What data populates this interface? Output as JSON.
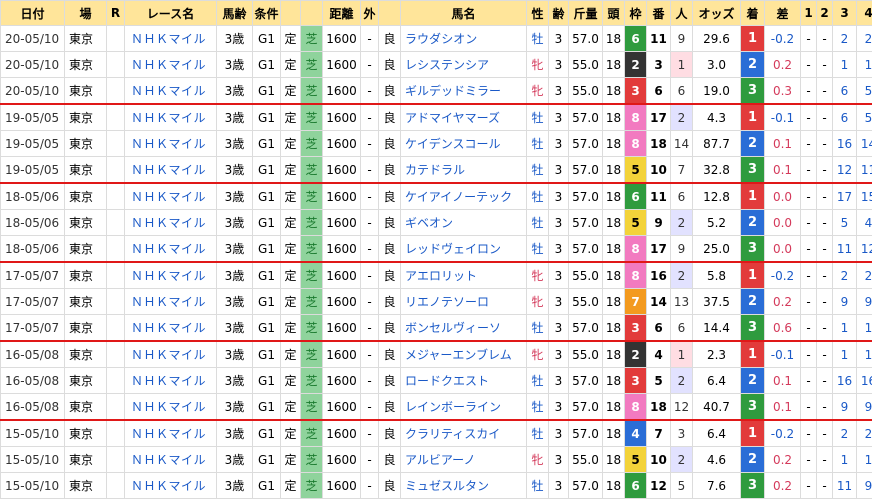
{
  "headers": [
    "日付",
    "場",
    "R",
    "レース名",
    "馬齢",
    "条件",
    "",
    "距離",
    "外",
    "",
    "馬名",
    "性",
    "齢",
    "斤量",
    "頭",
    "枠",
    "番",
    "人",
    "オッズ",
    "着",
    "差",
    "1",
    "2",
    "3",
    "4"
  ],
  "rows": [
    {
      "date": "20-05/10",
      "place": "東京",
      "race": "ＮＨＫマイル",
      "age": "3歳",
      "cond": "G1",
      "fix": "定",
      "surf": "芝",
      "dist": "1600",
      "out": "-",
      "going": "良",
      "horse": "ラウダシオン",
      "sex": "牡",
      "hage": "3",
      "weight": "57.0",
      "field": "18",
      "frame": "6",
      "num": "11",
      "pop": "9",
      "odds": "29.6",
      "finish": "1",
      "diff": "-0.2",
      "c1": "-",
      "c2": "-",
      "c3": "2",
      "c4": "2",
      "group_end": false
    },
    {
      "date": "20-05/10",
      "place": "東京",
      "race": "ＮＨＫマイル",
      "age": "3歳",
      "cond": "G1",
      "fix": "定",
      "surf": "芝",
      "dist": "1600",
      "out": "-",
      "going": "良",
      "horse": "レシステンシア",
      "sex": "牝",
      "hage": "3",
      "weight": "55.0",
      "field": "18",
      "frame": "2",
      "num": "3",
      "pop": "1",
      "odds": "3.0",
      "finish": "2",
      "diff": "0.2",
      "c1": "-",
      "c2": "-",
      "c3": "1",
      "c4": "1",
      "group_end": false
    },
    {
      "date": "20-05/10",
      "place": "東京",
      "race": "ＮＨＫマイル",
      "age": "3歳",
      "cond": "G1",
      "fix": "定",
      "surf": "芝",
      "dist": "1600",
      "out": "-",
      "going": "良",
      "horse": "ギルデッドミラー",
      "sex": "牝",
      "hage": "3",
      "weight": "55.0",
      "field": "18",
      "frame": "3",
      "num": "6",
      "pop": "6",
      "odds": "19.0",
      "finish": "3",
      "diff": "0.3",
      "c1": "-",
      "c2": "-",
      "c3": "6",
      "c4": "5",
      "group_end": true
    },
    {
      "date": "19-05/05",
      "place": "東京",
      "race": "ＮＨＫマイル",
      "age": "3歳",
      "cond": "G1",
      "fix": "定",
      "surf": "芝",
      "dist": "1600",
      "out": "-",
      "going": "良",
      "horse": "アドマイヤマーズ",
      "sex": "牡",
      "hage": "3",
      "weight": "57.0",
      "field": "18",
      "frame": "8",
      "num": "17",
      "pop": "2",
      "odds": "4.3",
      "finish": "1",
      "diff": "-0.1",
      "c1": "-",
      "c2": "-",
      "c3": "6",
      "c4": "5",
      "group_end": false
    },
    {
      "date": "19-05/05",
      "place": "東京",
      "race": "ＮＨＫマイル",
      "age": "3歳",
      "cond": "G1",
      "fix": "定",
      "surf": "芝",
      "dist": "1600",
      "out": "-",
      "going": "良",
      "horse": "ケイデンスコール",
      "sex": "牡",
      "hage": "3",
      "weight": "57.0",
      "field": "18",
      "frame": "8",
      "num": "18",
      "pop": "14",
      "odds": "87.7",
      "finish": "2",
      "diff": "0.1",
      "c1": "-",
      "c2": "-",
      "c3": "16",
      "c4": "14",
      "group_end": false
    },
    {
      "date": "19-05/05",
      "place": "東京",
      "race": "ＮＨＫマイル",
      "age": "3歳",
      "cond": "G1",
      "fix": "定",
      "surf": "芝",
      "dist": "1600",
      "out": "-",
      "going": "良",
      "horse": "カテドラル",
      "sex": "牡",
      "hage": "3",
      "weight": "57.0",
      "field": "18",
      "frame": "5",
      "num": "10",
      "pop": "7",
      "odds": "32.8",
      "finish": "3",
      "diff": "0.1",
      "c1": "-",
      "c2": "-",
      "c3": "12",
      "c4": "11",
      "group_end": true
    },
    {
      "date": "18-05/06",
      "place": "東京",
      "race": "ＮＨＫマイル",
      "age": "3歳",
      "cond": "G1",
      "fix": "定",
      "surf": "芝",
      "dist": "1600",
      "out": "-",
      "going": "良",
      "horse": "ケイアイノーテック",
      "sex": "牡",
      "hage": "3",
      "weight": "57.0",
      "field": "18",
      "frame": "6",
      "num": "11",
      "pop": "6",
      "odds": "12.8",
      "finish": "1",
      "diff": "0.0",
      "c1": "-",
      "c2": "-",
      "c3": "17",
      "c4": "15",
      "group_end": false
    },
    {
      "date": "18-05/06",
      "place": "東京",
      "race": "ＮＨＫマイル",
      "age": "3歳",
      "cond": "G1",
      "fix": "定",
      "surf": "芝",
      "dist": "1600",
      "out": "-",
      "going": "良",
      "horse": "ギベオン",
      "sex": "牡",
      "hage": "3",
      "weight": "57.0",
      "field": "18",
      "frame": "5",
      "num": "9",
      "pop": "2",
      "odds": "5.2",
      "finish": "2",
      "diff": "0.0",
      "c1": "-",
      "c2": "-",
      "c3": "5",
      "c4": "4",
      "group_end": false
    },
    {
      "date": "18-05/06",
      "place": "東京",
      "race": "ＮＨＫマイル",
      "age": "3歳",
      "cond": "G1",
      "fix": "定",
      "surf": "芝",
      "dist": "1600",
      "out": "-",
      "going": "良",
      "horse": "レッドヴェイロン",
      "sex": "牡",
      "hage": "3",
      "weight": "57.0",
      "field": "18",
      "frame": "8",
      "num": "17",
      "pop": "9",
      "odds": "25.0",
      "finish": "3",
      "diff": "0.0",
      "c1": "-",
      "c2": "-",
      "c3": "11",
      "c4": "12",
      "group_end": true
    },
    {
      "date": "17-05/07",
      "place": "東京",
      "race": "ＮＨＫマイル",
      "age": "3歳",
      "cond": "G1",
      "fix": "定",
      "surf": "芝",
      "dist": "1600",
      "out": "-",
      "going": "良",
      "horse": "アエロリット",
      "sex": "牝",
      "hage": "3",
      "weight": "55.0",
      "field": "18",
      "frame": "8",
      "num": "16",
      "pop": "2",
      "odds": "5.8",
      "finish": "1",
      "diff": "-0.2",
      "c1": "-",
      "c2": "-",
      "c3": "2",
      "c4": "2",
      "group_end": false
    },
    {
      "date": "17-05/07",
      "place": "東京",
      "race": "ＮＨＫマイル",
      "age": "3歳",
      "cond": "G1",
      "fix": "定",
      "surf": "芝",
      "dist": "1600",
      "out": "-",
      "going": "良",
      "horse": "リエノテソーロ",
      "sex": "牝",
      "hage": "3",
      "weight": "55.0",
      "field": "18",
      "frame": "7",
      "num": "14",
      "pop": "13",
      "odds": "37.5",
      "finish": "2",
      "diff": "0.2",
      "c1": "-",
      "c2": "-",
      "c3": "9",
      "c4": "9",
      "group_end": false
    },
    {
      "date": "17-05/07",
      "place": "東京",
      "race": "ＮＨＫマイル",
      "age": "3歳",
      "cond": "G1",
      "fix": "定",
      "surf": "芝",
      "dist": "1600",
      "out": "-",
      "going": "良",
      "horse": "ボンセルヴィーソ",
      "sex": "牡",
      "hage": "3",
      "weight": "57.0",
      "field": "18",
      "frame": "3",
      "num": "6",
      "pop": "6",
      "odds": "14.4",
      "finish": "3",
      "diff": "0.6",
      "c1": "-",
      "c2": "-",
      "c3": "1",
      "c4": "1",
      "group_end": true
    },
    {
      "date": "16-05/08",
      "place": "東京",
      "race": "ＮＨＫマイル",
      "age": "3歳",
      "cond": "G1",
      "fix": "定",
      "surf": "芝",
      "dist": "1600",
      "out": "-",
      "going": "良",
      "horse": "メジャーエンブレム",
      "sex": "牝",
      "hage": "3",
      "weight": "55.0",
      "field": "18",
      "frame": "2",
      "num": "4",
      "pop": "1",
      "odds": "2.3",
      "finish": "1",
      "diff": "-0.1",
      "c1": "-",
      "c2": "-",
      "c3": "1",
      "c4": "1",
      "group_end": false
    },
    {
      "date": "16-05/08",
      "place": "東京",
      "race": "ＮＨＫマイル",
      "age": "3歳",
      "cond": "G1",
      "fix": "定",
      "surf": "芝",
      "dist": "1600",
      "out": "-",
      "going": "良",
      "horse": "ロードクエスト",
      "sex": "牡",
      "hage": "3",
      "weight": "57.0",
      "field": "18",
      "frame": "3",
      "num": "5",
      "pop": "2",
      "odds": "6.4",
      "finish": "2",
      "diff": "0.1",
      "c1": "-",
      "c2": "-",
      "c3": "16",
      "c4": "16",
      "group_end": false
    },
    {
      "date": "16-05/08",
      "place": "東京",
      "race": "ＮＨＫマイル",
      "age": "3歳",
      "cond": "G1",
      "fix": "定",
      "surf": "芝",
      "dist": "1600",
      "out": "-",
      "going": "良",
      "horse": "レインボーライン",
      "sex": "牡",
      "hage": "3",
      "weight": "57.0",
      "field": "18",
      "frame": "8",
      "num": "18",
      "pop": "12",
      "odds": "40.7",
      "finish": "3",
      "diff": "0.1",
      "c1": "-",
      "c2": "-",
      "c3": "9",
      "c4": "9",
      "group_end": true
    },
    {
      "date": "15-05/10",
      "place": "東京",
      "race": "ＮＨＫマイル",
      "age": "3歳",
      "cond": "G1",
      "fix": "定",
      "surf": "芝",
      "dist": "1600",
      "out": "-",
      "going": "良",
      "horse": "クラリティスカイ",
      "sex": "牡",
      "hage": "3",
      "weight": "57.0",
      "field": "18",
      "frame": "4",
      "num": "7",
      "pop": "3",
      "odds": "6.4",
      "finish": "1",
      "diff": "-0.2",
      "c1": "-",
      "c2": "-",
      "c3": "2",
      "c4": "2",
      "group_end": false
    },
    {
      "date": "15-05/10",
      "place": "東京",
      "race": "ＮＨＫマイル",
      "age": "3歳",
      "cond": "G1",
      "fix": "定",
      "surf": "芝",
      "dist": "1600",
      "out": "-",
      "going": "良",
      "horse": "アルビアーノ",
      "sex": "牝",
      "hage": "3",
      "weight": "55.0",
      "field": "18",
      "frame": "5",
      "num": "10",
      "pop": "2",
      "odds": "4.6",
      "finish": "2",
      "diff": "0.2",
      "c1": "-",
      "c2": "-",
      "c3": "1",
      "c4": "1",
      "group_end": false
    },
    {
      "date": "15-05/10",
      "place": "東京",
      "race": "ＮＨＫマイル",
      "age": "3歳",
      "cond": "G1",
      "fix": "定",
      "surf": "芝",
      "dist": "1600",
      "out": "-",
      "going": "良",
      "horse": "ミュゼスルタン",
      "sex": "牡",
      "hage": "3",
      "weight": "57.0",
      "field": "18",
      "frame": "6",
      "num": "12",
      "pop": "5",
      "odds": "7.6",
      "finish": "3",
      "diff": "0.2",
      "c1": "-",
      "c2": "-",
      "c3": "11",
      "c4": "9",
      "group_end": false
    }
  ]
}
